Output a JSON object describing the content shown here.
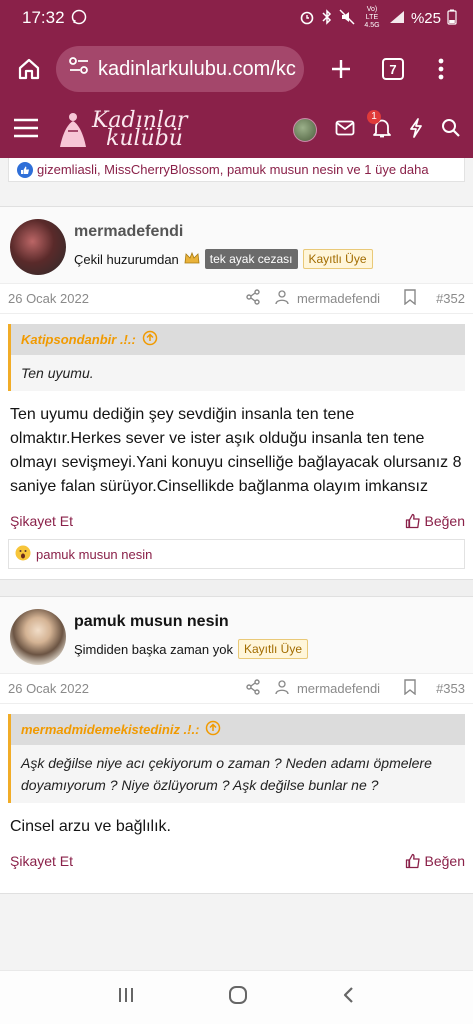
{
  "status_bar": {
    "time": "17:32",
    "battery": "%25",
    "network": "Vo) LTE 4.5G"
  },
  "browser": {
    "url": "kadinlarkulubu.com/kc",
    "tab_count": "7"
  },
  "site": {
    "logo_line1": "Kadınlar",
    "logo_line2": "kulübü",
    "notification_count": "1"
  },
  "reactions_top": "gizemliasli, MissCherryBlossom, pamuk musun nesin ve 1 üye daha",
  "posts": [
    {
      "username": "mermadefendi",
      "user_title": "Çekil huzurumdan",
      "tag_dark": "tek ayak cezası",
      "tag_registered": "Kayıtlı Üye",
      "date": "26 Ocak 2022",
      "author_ref": "mermadefendi",
      "post_number": "#352",
      "quote_author": "Katipsondanbir .!.:",
      "quote_text": "Ten uyumu.",
      "message": "Ten uyumu dediğin şey sevdiğin insanla ten tene olmaktır.Herkes sever ve ister aşık olduğu insanla ten tene olmayı sevişmeyi.Yani konuyu cinselliğe bağlayacak olursanız 8 saniye falan sürüyor.Cinsellikde bağlanma olayım imkansız",
      "report_label": "Şikayet Et",
      "like_label": "Beğen",
      "reactions": "pamuk musun nesin"
    },
    {
      "username": "pamuk musun nesin",
      "user_title": "Şimdiden başka zaman yok",
      "tag_registered": "Kayıtlı Üye",
      "date": "26 Ocak 2022",
      "author_ref": "mermadefendi",
      "post_number": "#353",
      "quote_author": "mermadmidemekistediniz .!.:",
      "quote_text": "Aşk değilse niye acı çekiyorum o zaman ? Neden adamı öpmelere doyamıyorum ? Niye özlüyorum ? Aşk değilse bunlar ne ?",
      "message": "Cinsel arzu ve bağlılık.",
      "report_label": "Şikayet Et",
      "like_label": "Beğen"
    }
  ],
  "colors": {
    "brand": "#8a2149",
    "quote_accent": "#f1ac27"
  }
}
